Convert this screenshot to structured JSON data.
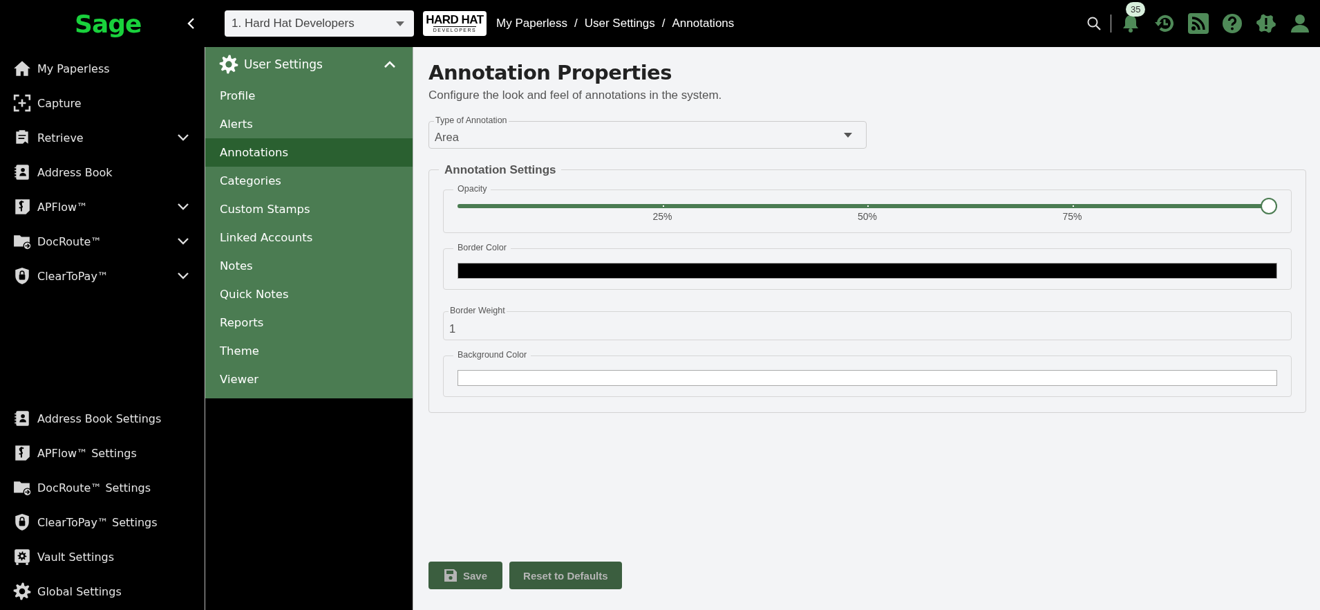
{
  "topbar": {
    "logo": "Sage",
    "company_select": {
      "value": "1. Hard Hat Developers"
    },
    "company_logo": {
      "name": "HARD HAT",
      "subtitle": "DEVELOPERS"
    },
    "breadcrumbs": [
      "My Paperless",
      "User Settings",
      "Annotations"
    ],
    "breadcrumb_separator": "/",
    "notification_count": "35"
  },
  "nav": {
    "items": [
      {
        "label": "My Paperless",
        "expandable": false
      },
      {
        "label": "Capture",
        "expandable": false
      },
      {
        "label": "Retrieve",
        "expandable": true
      },
      {
        "label": "Address Book",
        "expandable": false
      },
      {
        "label": "APFlow™",
        "expandable": true
      },
      {
        "label": "DocRoute™",
        "expandable": true
      },
      {
        "label": "ClearToPay™",
        "expandable": true
      }
    ],
    "settings_items": [
      {
        "label": "Address Book Settings"
      },
      {
        "label": "APFlow™ Settings"
      },
      {
        "label": "DocRoute™ Settings"
      },
      {
        "label": "ClearToPay™ Settings"
      },
      {
        "label": "Vault Settings"
      },
      {
        "label": "Global Settings"
      }
    ]
  },
  "subnav": {
    "title": "User Settings",
    "expanded": true,
    "items": [
      {
        "label": "Profile",
        "selected": false
      },
      {
        "label": "Alerts",
        "selected": false
      },
      {
        "label": "Annotations",
        "selected": true
      },
      {
        "label": "Categories",
        "selected": false
      },
      {
        "label": "Custom Stamps",
        "selected": false
      },
      {
        "label": "Linked Accounts",
        "selected": false
      },
      {
        "label": "Notes",
        "selected": false
      },
      {
        "label": "Quick Notes",
        "selected": false
      },
      {
        "label": "Reports",
        "selected": false
      },
      {
        "label": "Theme",
        "selected": false
      },
      {
        "label": "Viewer",
        "selected": false
      }
    ]
  },
  "main": {
    "title": "Annotation Properties",
    "subtitle": "Configure the look and feel of annotations in the system.",
    "type_field": {
      "label": "Type of Annotation",
      "value": "Area"
    },
    "settings": {
      "legend": "Annotation Settings",
      "opacity": {
        "label": "Opacity",
        "level": 1,
        "ticks": [
          "25%",
          "50%",
          "75%"
        ]
      },
      "border_color": {
        "label": "Border Color",
        "color": "#000000"
      },
      "border_weight": {
        "label": "Border Weight",
        "value": "1"
      },
      "background_color": {
        "label": "Background Color",
        "color": "#ffffff"
      }
    },
    "buttons": [
      {
        "label": "Save",
        "kind": "save",
        "disabled": true
      },
      {
        "label": "Reset to Defaults",
        "kind": "plain",
        "disabled": true
      }
    ]
  }
}
